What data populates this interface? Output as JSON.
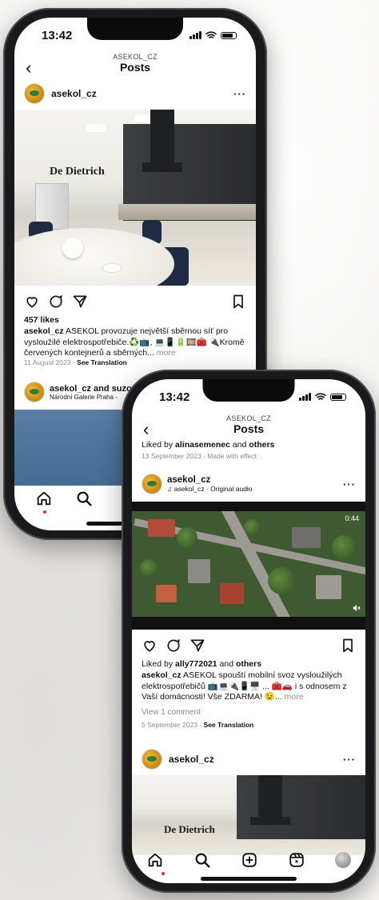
{
  "back_phone": {
    "status_time": "13:42",
    "nav": {
      "subtitle": "ASEKOL_CZ",
      "title": "Posts"
    },
    "post1": {
      "username": "asekol_cz",
      "image_brand_text": "De Dietrich",
      "likes": "457 likes",
      "caption_user": "asekol_cz",
      "caption_text": "ASEKOL provozuje největší sběrnou síť pro vysloužilé elektrospotřebiče.♻️📺, 💻📱🔋🎞️🧰 🔌Kromě červených kontejnerů a sběrných...",
      "more": "more",
      "date": "11 August 2023",
      "see_translation": "See Translation"
    },
    "post2": {
      "username_line": "asekol_cz and suzonfu",
      "location": "Národní Galerie Praha - "
    }
  },
  "front_phone": {
    "status_time": "13:42",
    "nav": {
      "subtitle": "ASEKOL_CZ",
      "title": "Posts"
    },
    "prev_post": {
      "liked_prefix": "Liked by ",
      "liked_user": "alinasemenec",
      "liked_mid": " and ",
      "liked_others": "others",
      "meta": "13 September 2023 · Made with effect"
    },
    "reel_post": {
      "username": "asekol_cz",
      "audio": "asekol_cz · Original audio",
      "video_time": "0:44",
      "liked_prefix": "Liked by ",
      "liked_user": "ally772021",
      "liked_mid": " and ",
      "liked_others": "others",
      "caption_user": "asekol_cz",
      "caption_text": "ASEKOL spouští mobilní svoz vysloužilých elektrospotřebičů 📺💻🔌📱🖥️ ... 🧰🚗 i s odnosem z Vaší domácnosti! Vše ZDARMA! 😉...",
      "more": "more",
      "view_comments": "View 1 comment",
      "date": "5 September 2023",
      "see_translation": "See Translation"
    },
    "next_post": {
      "username": "asekol_cz",
      "image_brand_text": "De Dietrich"
    }
  }
}
